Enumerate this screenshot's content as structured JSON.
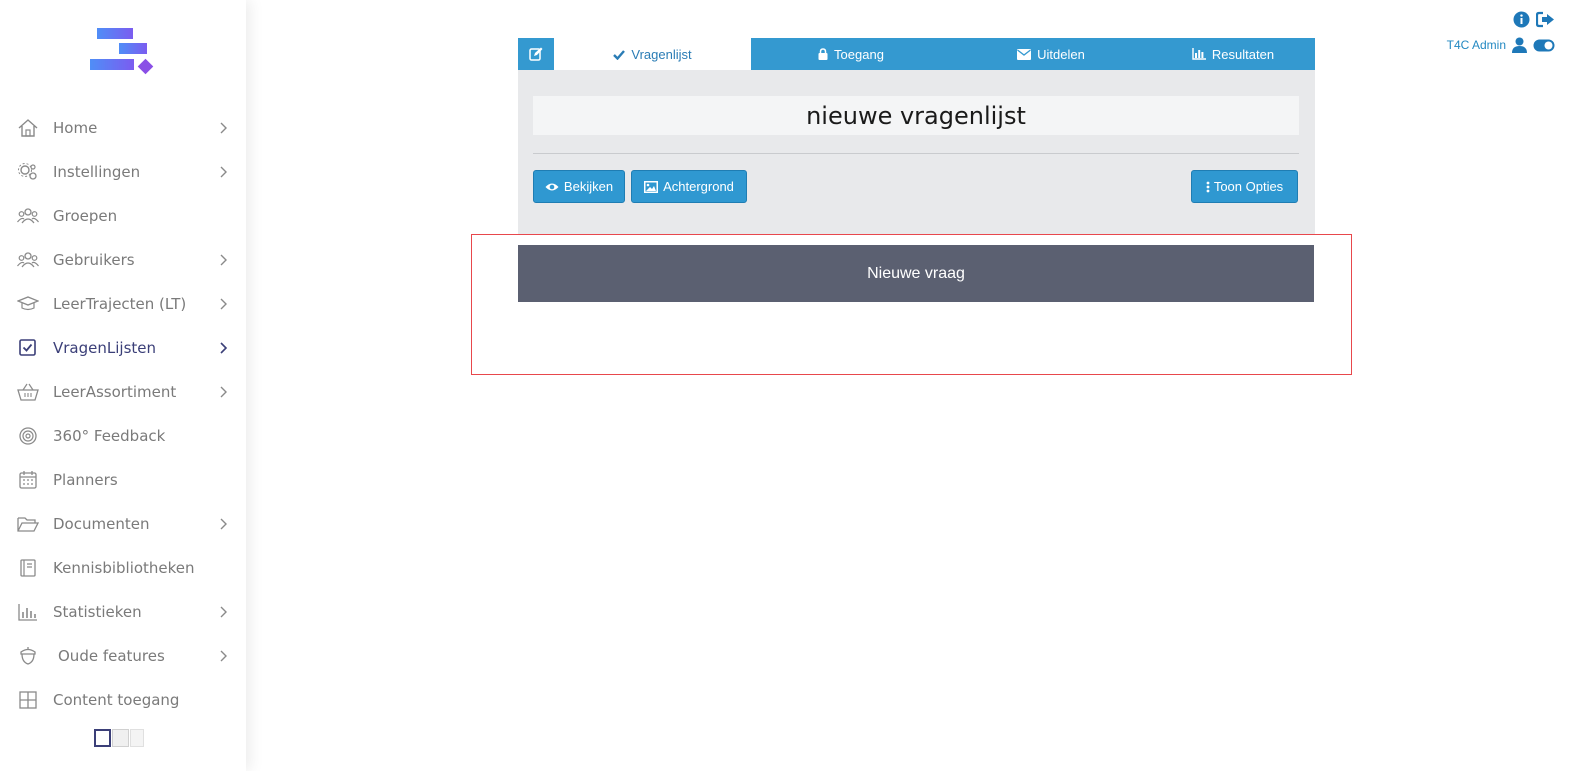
{
  "sidebar": {
    "items": [
      {
        "label": "Home",
        "icon": "home-icon",
        "chevron": true
      },
      {
        "label": "Instellingen",
        "icon": "gears-icon",
        "chevron": true
      },
      {
        "label": "Groepen",
        "icon": "group-icon",
        "chevron": false
      },
      {
        "label": "Gebruikers",
        "icon": "users-icon",
        "chevron": true
      },
      {
        "label": "LeerTrajecten (LT)",
        "icon": "graduation-cap-icon",
        "chevron": true
      },
      {
        "label": "VragenLijsten",
        "icon": "checkbox-icon",
        "chevron": true,
        "active": true
      },
      {
        "label": "LeerAssortiment",
        "icon": "basket-icon",
        "chevron": true
      },
      {
        "label": "360° Feedback",
        "icon": "target-icon",
        "chevron": false
      },
      {
        "label": "Planners",
        "icon": "calendar-icon",
        "chevron": false
      },
      {
        "label": "Documenten",
        "icon": "folder-open-icon",
        "chevron": true
      },
      {
        "label": "Kennisbibliotheken",
        "icon": "book-icon",
        "chevron": false
      },
      {
        "label": "Statistieken",
        "icon": "bar-chart-icon",
        "chevron": true
      },
      {
        "label": "Oude features",
        "icon": "acorn-icon",
        "chevron": true
      },
      {
        "label": "Content toegang",
        "icon": "grid-icon",
        "chevron": false
      }
    ]
  },
  "header": {
    "user_name": "T4C Admin"
  },
  "tabs": {
    "vragenlijst": "Vragenlijst",
    "toegang": "Toegang",
    "uitdelen": "Uitdelen",
    "resultaten": "Resultaten"
  },
  "form": {
    "title": "nieuwe vragenlijst",
    "bekijken_label": "Bekijken",
    "achtergrond_label": "Achtergrond",
    "opties_label": "Toon Opties",
    "new_question_label": "Nieuwe vraag"
  },
  "colors": {
    "accent": "#3499d0",
    "active_nav": "#3b3f78",
    "question_bar": "#5b6071",
    "highlight_frame": "#e8474c"
  }
}
